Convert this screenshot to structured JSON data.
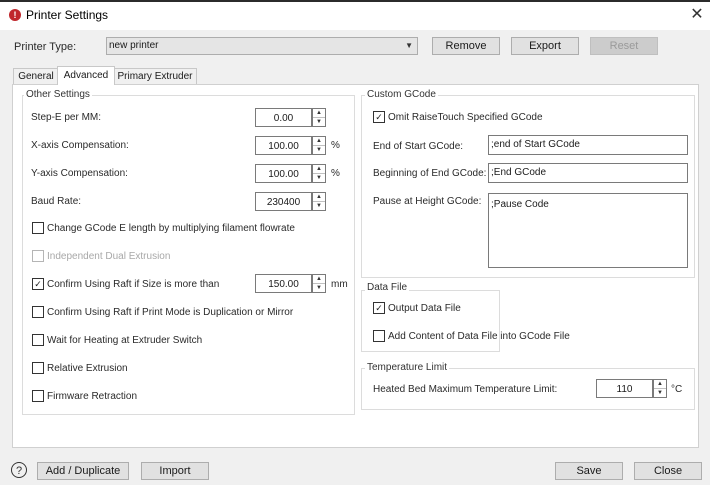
{
  "window": {
    "title": "Printer Settings",
    "close_glyph": "✕",
    "help_glyph": "?"
  },
  "printer_type": {
    "label": "Printer Type:",
    "value": "new printer"
  },
  "top_buttons": {
    "remove": "Remove",
    "export": "Export",
    "reset": "Reset"
  },
  "tabs": [
    "General",
    "Advanced",
    "Primary Extruder"
  ],
  "other_settings": {
    "title": "Other Settings",
    "step_e": {
      "label": "Step-E per MM:",
      "value": "0.00"
    },
    "x_comp": {
      "label": "X-axis Compensation:",
      "value": "100.00",
      "unit": "%"
    },
    "y_comp": {
      "label": "Y-axis Compensation:",
      "value": "100.00",
      "unit": "%"
    },
    "baud": {
      "label": "Baud Rate:",
      "value": "230400"
    },
    "change_gcode": "Change GCode E length by multiplying filament flowrate",
    "independent_dual": "Independent Dual Extrusion",
    "raft_size": {
      "label": "Confirm Using Raft if Size is more than",
      "value": "150.00",
      "unit": "mm"
    },
    "raft_mode": "Confirm Using Raft if Print Mode is Duplication or Mirror",
    "wait_heating": "Wait for Heating at Extruder Switch",
    "relative_extrusion": "Relative Extrusion",
    "firmware_retraction": "Firmware Retraction"
  },
  "custom_gcode": {
    "title": "Custom GCode",
    "omit_raise": "Omit RaiseTouch Specified GCode",
    "end_of_start": {
      "label": "End of Start GCode:",
      "value": ";end of Start GCode"
    },
    "beginning_of_end": {
      "label": "Beginning of End GCode:",
      "value": ";End GCode"
    },
    "pause_at_height": {
      "label": "Pause at Height GCode:",
      "value": ";Pause Code"
    }
  },
  "data_file": {
    "title": "Data File",
    "output": "Output Data File",
    "add_content": "Add Content of Data File into GCode File"
  },
  "temperature_limit": {
    "title": "Temperature Limit",
    "label": "Heated Bed Maximum Temperature Limit:",
    "value": "110",
    "unit": "°C"
  },
  "bottom_buttons": {
    "add_duplicate": "Add / Duplicate",
    "import": "Import",
    "save": "Save",
    "close": "Close"
  },
  "checkbox_states": {
    "change_gcode": false,
    "independent_dual": false,
    "raft_size": true,
    "raft_mode": false,
    "wait_heating": false,
    "relative_extrusion": false,
    "firmware_retraction": false,
    "omit_raise": true,
    "output_data": true,
    "add_content": false
  },
  "colors": {
    "accent_red": "#c0272d",
    "panel_bg": "#ffffff",
    "window_bg": "#f0f0f0"
  }
}
